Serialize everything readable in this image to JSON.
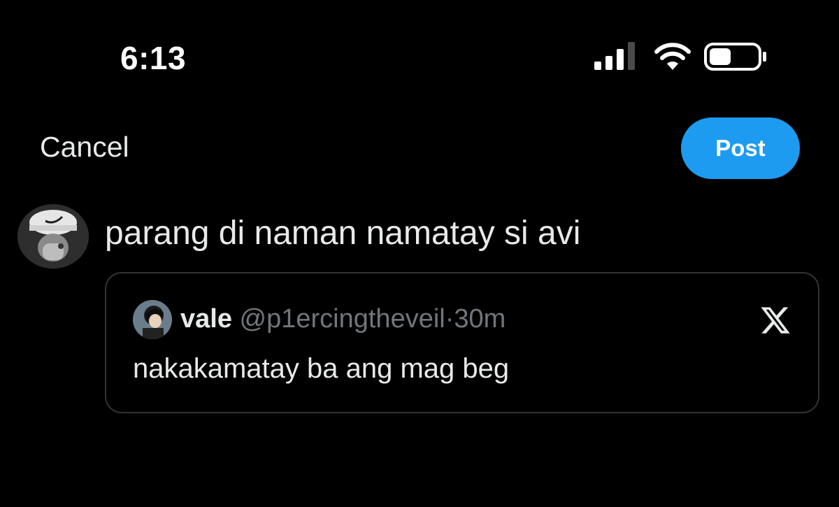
{
  "status_bar": {
    "time": "6:13"
  },
  "header": {
    "cancel_label": "Cancel",
    "post_label": "Post"
  },
  "compose": {
    "text": "parang di naman namatay si avi"
  },
  "quote": {
    "name": "vale",
    "handle": "@p1ercingtheveil",
    "separator": "·",
    "time": "30m",
    "text": "nakakamatay ba ang mag beg"
  },
  "colors": {
    "background": "#000000",
    "accent": "#1d9bf0",
    "text_primary": "#e7e9ea",
    "text_secondary": "#71767b",
    "border": "#2f3336"
  },
  "icons": {
    "signal": "signal-icon",
    "wifi": "wifi-icon",
    "battery": "battery-icon",
    "x_logo": "x-logo-icon"
  }
}
